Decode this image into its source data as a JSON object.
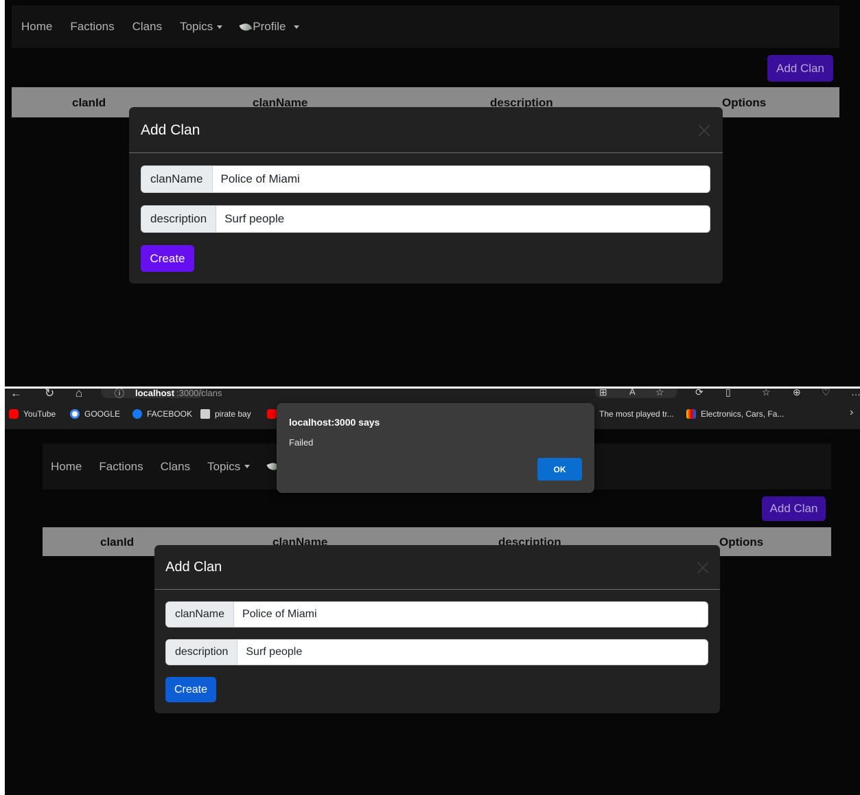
{
  "navbar": {
    "items": [
      {
        "label": "Home"
      },
      {
        "label": "Factions"
      },
      {
        "label": "Clans"
      },
      {
        "label": "Topics"
      },
      {
        "label": "Profile"
      }
    ]
  },
  "add_clan_button": "Add Clan",
  "table": {
    "headers": [
      "clanId",
      "clanName",
      "description",
      "Options"
    ]
  },
  "modal": {
    "title": "Add Clan",
    "fields": [
      {
        "label": "clanName",
        "value": "Police of Miami"
      },
      {
        "label": "description",
        "value": "Surf people"
      }
    ],
    "submit_label": "Create"
  },
  "browser": {
    "url_host": "localhost",
    "url_path": ":3000/clans",
    "bookmarks": [
      {
        "label": "YouTube"
      },
      {
        "label": "GOOGLE"
      },
      {
        "label": "FACEBOOK"
      },
      {
        "label": "pirate bay"
      },
      {
        "label": "The most played tr..."
      },
      {
        "label": "Electronics, Cars, Fa..."
      }
    ]
  },
  "alert": {
    "title": "localhost:3000 says",
    "message": "Failed",
    "ok_label": "OK"
  },
  "colors": {
    "page_background": "#070707",
    "navbar_background": "#121212",
    "add_clan_button": "#3a0f9c",
    "create_button_first": "#6610f2",
    "create_button_second": "#0d5ed4",
    "alert_ok": "#0a6ed1"
  }
}
